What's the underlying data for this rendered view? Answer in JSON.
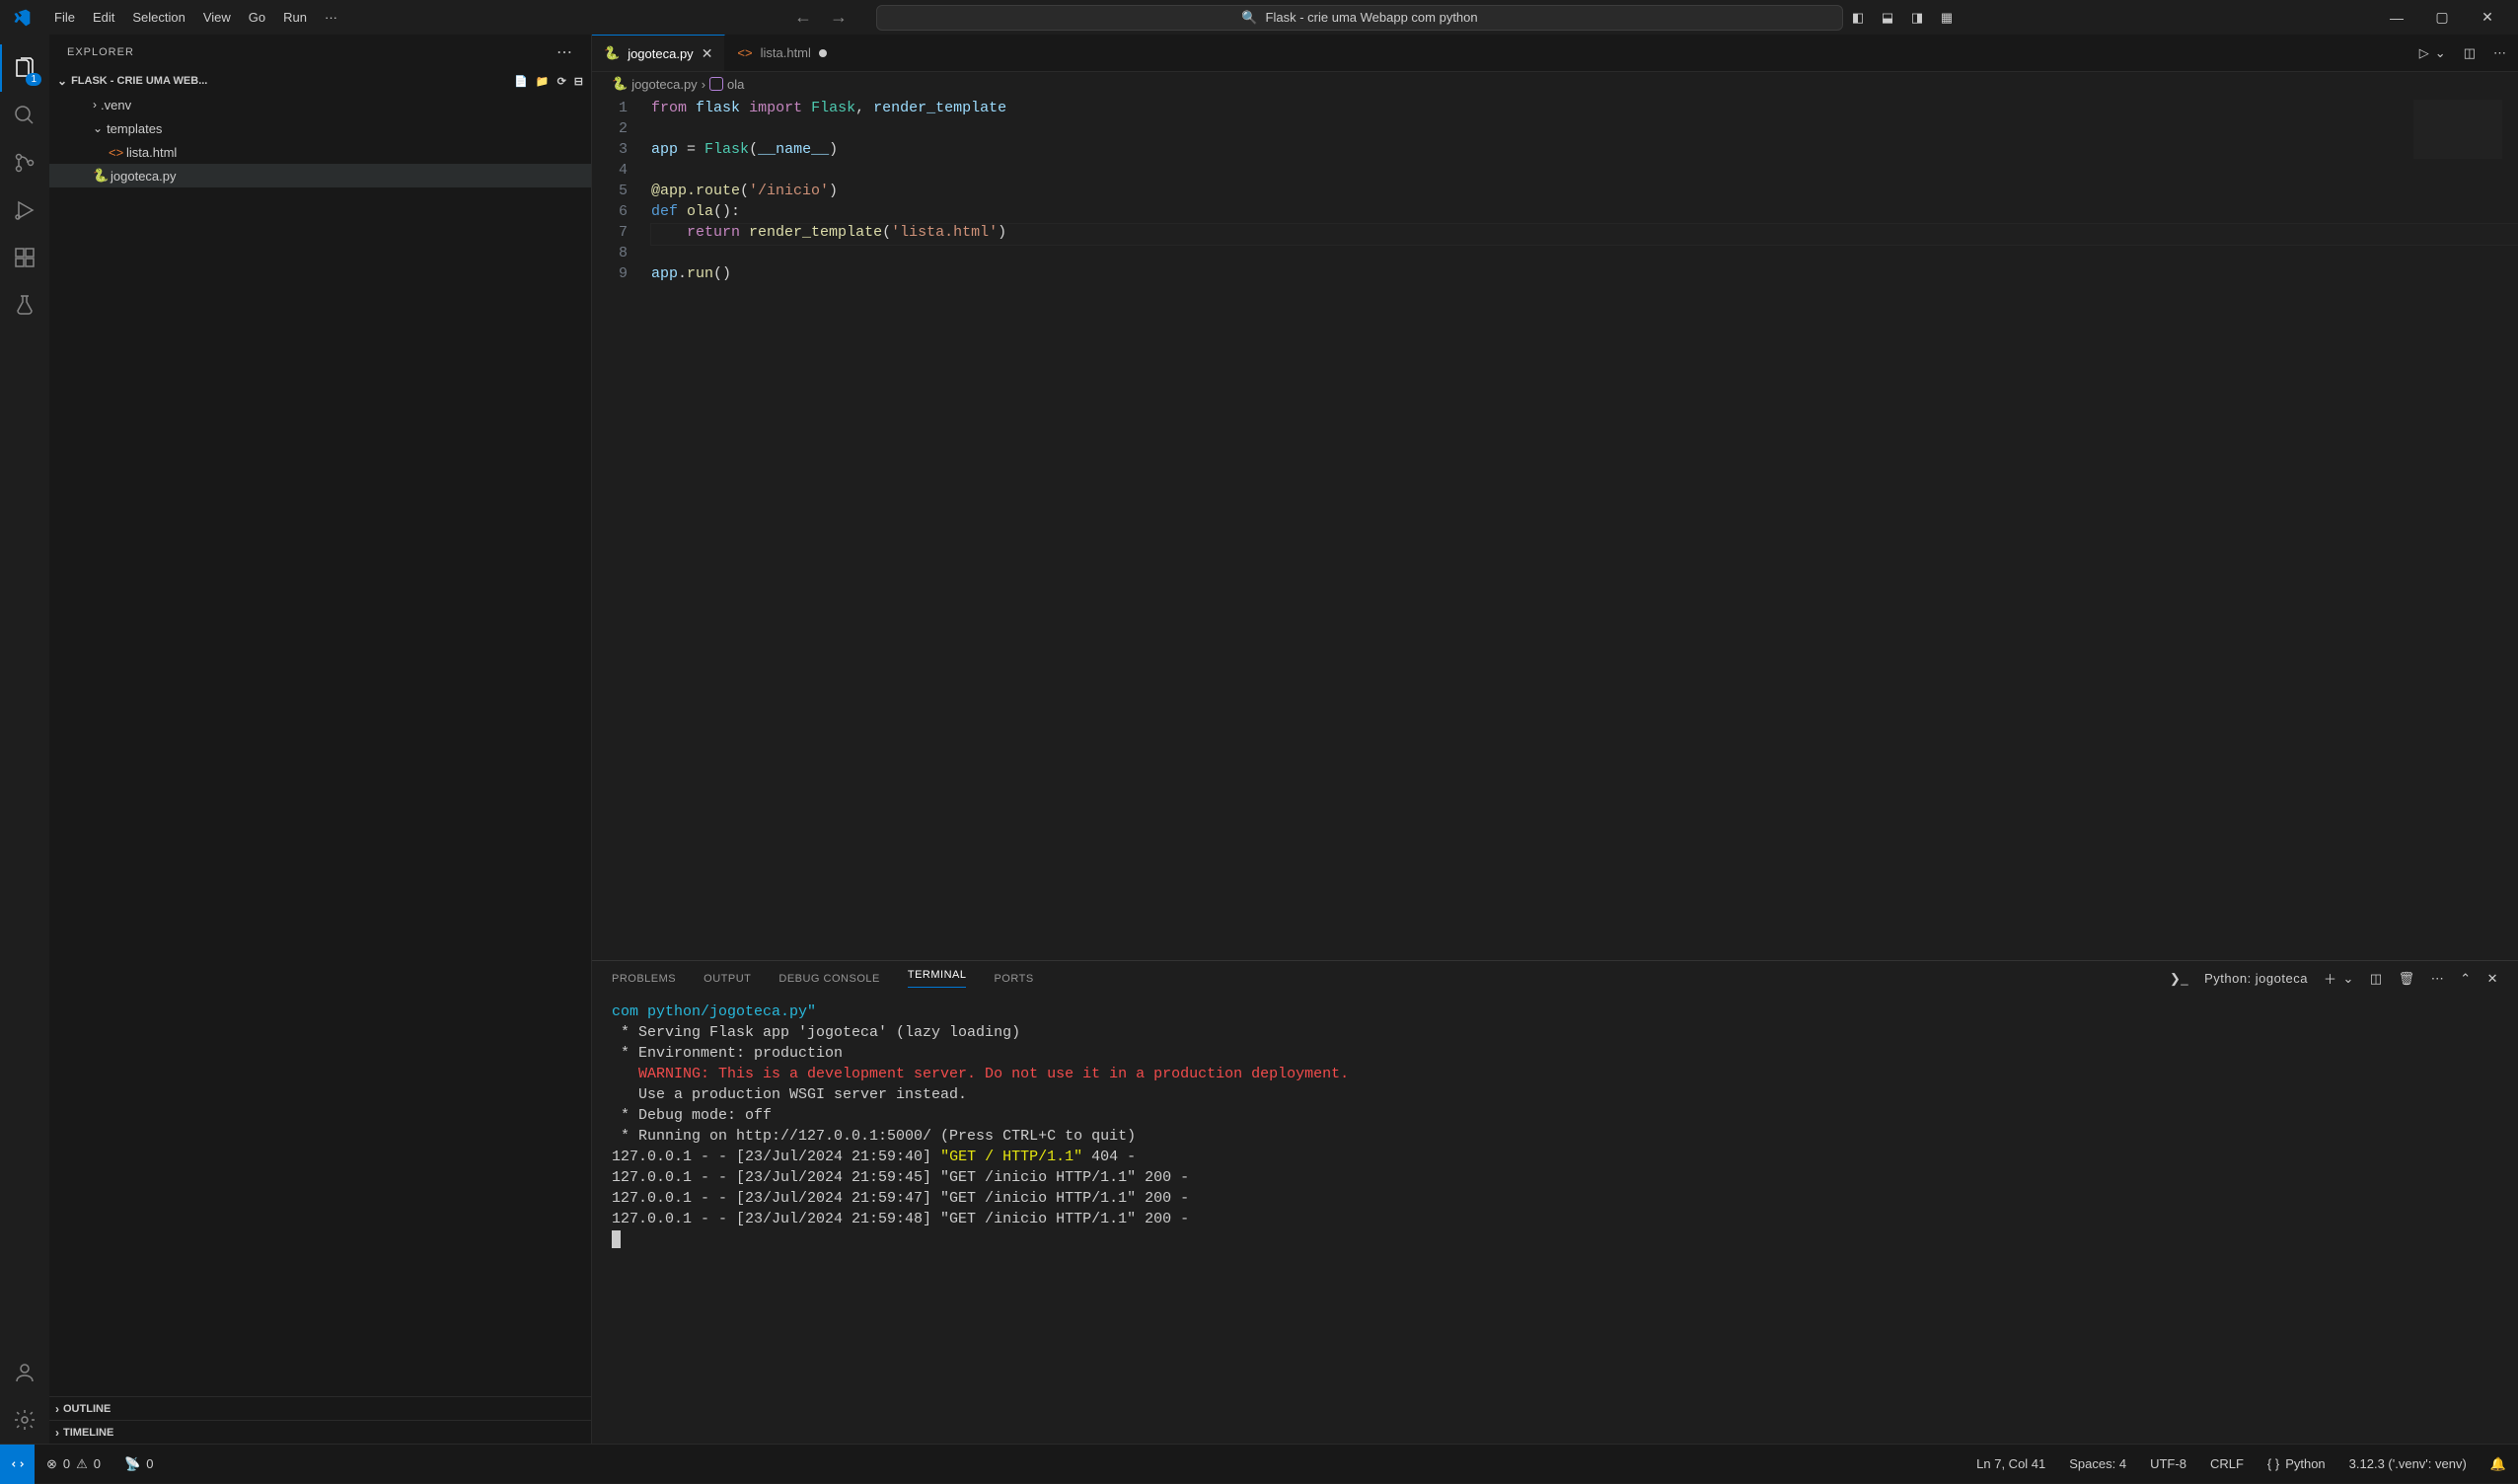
{
  "menubar": [
    "File",
    "Edit",
    "Selection",
    "View",
    "Go",
    "Run",
    "···"
  ],
  "search_text": "Flask - crie uma Webapp com python",
  "activity_badge": "1",
  "sidebar": {
    "title": "EXPLORER",
    "folder": "FLASK - CRIE UMA WEB...",
    "tree": [
      {
        "chev": "›",
        "name": ".venv",
        "indent": 1
      },
      {
        "chev": "⌄",
        "name": "templates",
        "indent": 1
      },
      {
        "icon": "<>",
        "name": "lista.html",
        "indent": 2,
        "iconColor": "#e37933"
      },
      {
        "icon": "🐍",
        "name": "jogoteca.py",
        "indent": 1,
        "selected": true,
        "iconColor": "#4b8bbe"
      }
    ],
    "outline": "OUTLINE",
    "timeline": "TIMELINE"
  },
  "tabs": [
    {
      "icon": "py",
      "label": "jogoteca.py",
      "active": true,
      "dirty": false
    },
    {
      "icon": "html",
      "label": "lista.html",
      "active": false,
      "dirty": true
    }
  ],
  "breadcrumb": {
    "file": "jogoteca.py",
    "symbol": "ola"
  },
  "code": {
    "lines": [
      {
        "n": 1,
        "html": "<span class='kw-import'>from</span> <span class='var'>flask</span> <span class='kw-import'>import</span> <span class='cls'>Flask</span><span class='plain'>, </span><span class='var'>render_template</span>"
      },
      {
        "n": 2,
        "html": ""
      },
      {
        "n": 3,
        "html": "<span class='var'>app</span> <span class='plain'>= </span><span class='cls'>Flask</span><span class='plain'>(</span><span class='var'>__name__</span><span class='plain'>)</span>"
      },
      {
        "n": 4,
        "html": ""
      },
      {
        "n": 5,
        "html": "<span class='dec'>@app.route</span><span class='plain'>(</span><span class='str'>'/inicio'</span><span class='plain'>)</span>"
      },
      {
        "n": 6,
        "html": "<span class='kw-def'>def</span> <span class='fn'>ola</span><span class='plain'>():</span>"
      },
      {
        "n": 7,
        "html": "    <span class='kw-import'>return</span> <span class='fn'>render_template</span><span class='plain'>(</span><span class='str'>'lista.html'</span><span class='plain'>)</span>",
        "hl": true
      },
      {
        "n": 8,
        "html": ""
      },
      {
        "n": 9,
        "html": "<span class='var'>app</span><span class='plain'>.</span><span class='fn'>run</span><span class='plain'>()</span>"
      }
    ]
  },
  "panel": {
    "tabs": [
      "PROBLEMS",
      "OUTPUT",
      "DEBUG CONSOLE",
      "TERMINAL",
      "PORTS"
    ],
    "active": "TERMINAL",
    "term_label": "Python: jogoteca",
    "terminal_lines": [
      {
        "cls": "cyan",
        "text": "com python/jogoteca.py\""
      },
      {
        "cls": "",
        "text": " * Serving Flask app 'jogoteca' (lazy loading)"
      },
      {
        "cls": "",
        "text": " * Environment: production"
      },
      {
        "cls": "red",
        "text": "   WARNING: This is a development server. Do not use it in a production deployment."
      },
      {
        "cls": "",
        "text": "   Use a production WSGI server instead."
      },
      {
        "cls": "",
        "text": " * Debug mode: off"
      },
      {
        "cls": "",
        "text": " * Running on http://127.0.0.1:5000/ (Press CTRL+C to quit)"
      },
      {
        "mixed": true,
        "pre": "127.0.0.1 - - [23/Jul/2024 21:59:40] ",
        "y": "\"GET / HTTP/1.1\"",
        "post": " 404 -"
      },
      {
        "cls": "",
        "text": "127.0.0.1 - - [23/Jul/2024 21:59:45] \"GET /inicio HTTP/1.1\" 200 -"
      },
      {
        "cls": "",
        "text": "127.0.0.1 - - [23/Jul/2024 21:59:47] \"GET /inicio HTTP/1.1\" 200 -"
      },
      {
        "cls": "",
        "text": "127.0.0.1 - - [23/Jul/2024 21:59:48] \"GET /inicio HTTP/1.1\" 200 -"
      }
    ]
  },
  "status": {
    "errors": "0",
    "warnings": "0",
    "ports": "0",
    "cursor": "Ln 7, Col 41",
    "spaces": "Spaces: 4",
    "encoding": "UTF-8",
    "eol": "CRLF",
    "lang": "Python",
    "pyver": "3.12.3 ('.venv': venv)"
  }
}
